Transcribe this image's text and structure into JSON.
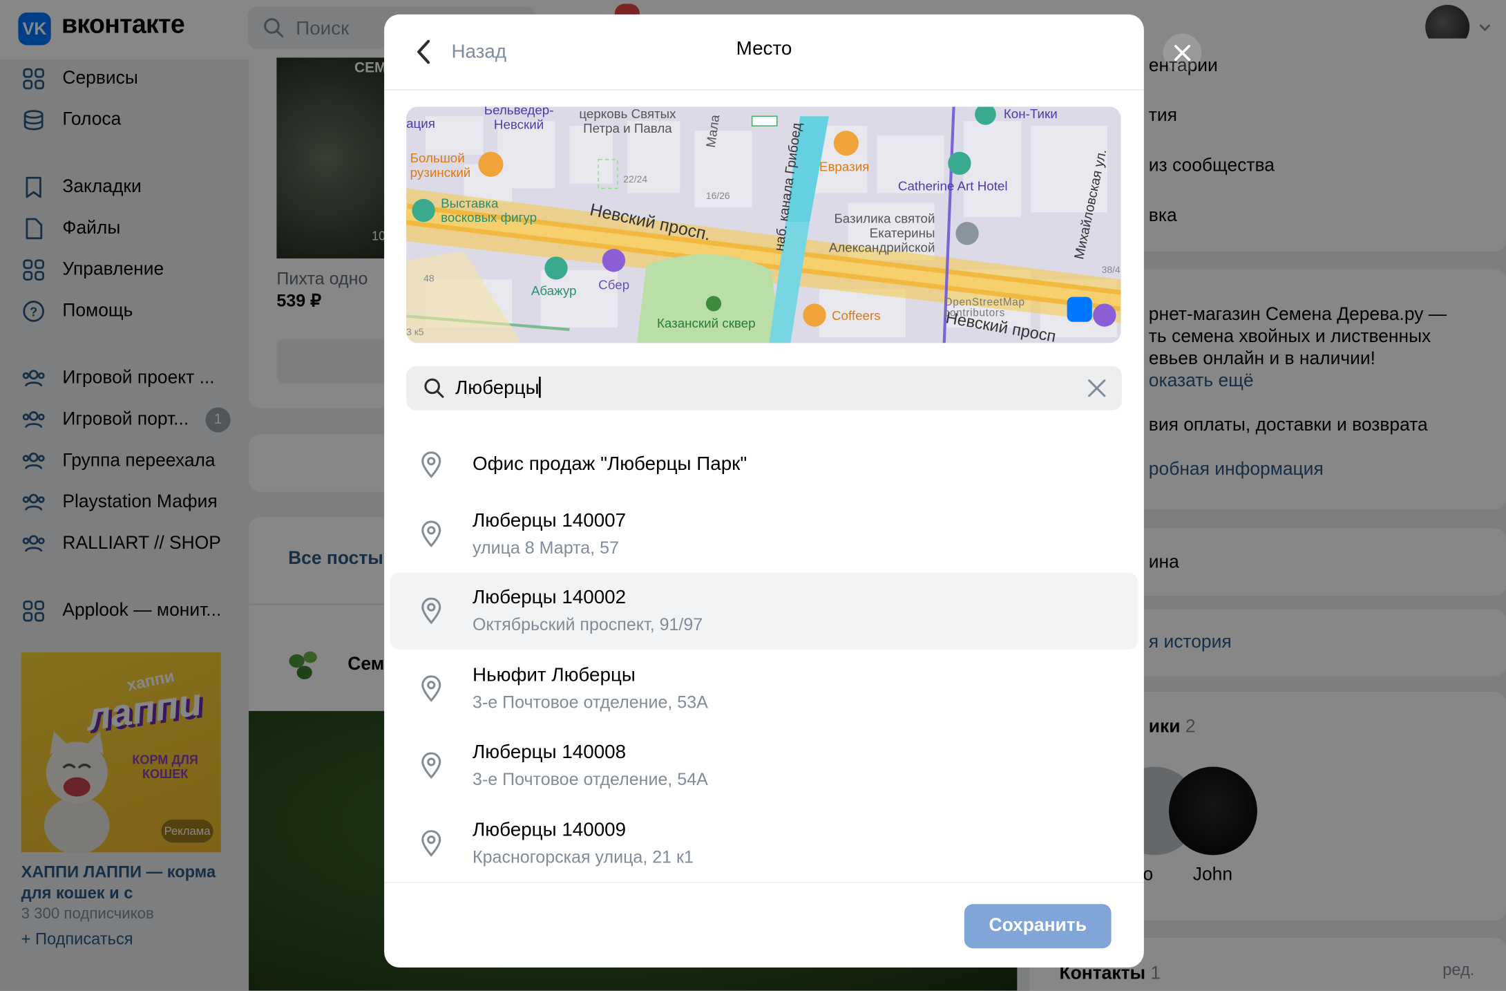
{
  "app": {
    "name": "вконтакте",
    "logo": "VK"
  },
  "header": {
    "search_placeholder": "Поиск"
  },
  "sidebar": {
    "items": [
      {
        "label": "Сервисы",
        "icon": "grid-icon"
      },
      {
        "label": "Голоса",
        "icon": "coins-icon"
      },
      {
        "label": "Закладки",
        "icon": "bookmark-icon"
      },
      {
        "label": "Файлы",
        "icon": "file-icon"
      },
      {
        "label": "Управление",
        "icon": "grid-icon"
      },
      {
        "label": "Помощь",
        "icon": "help-icon"
      },
      {
        "label": "Игровой проект ...",
        "icon": "group-icon"
      },
      {
        "label": "Игровой порт...",
        "icon": "group-icon",
        "badge": "1"
      },
      {
        "label": "Группа переехала",
        "icon": "group-icon"
      },
      {
        "label": "Playstation Мафия",
        "icon": "group-icon"
      },
      {
        "label": "RALLIART // SHOP",
        "icon": "group-icon"
      },
      {
        "label": "Applook — монит...",
        "icon": "grid-icon"
      }
    ],
    "ad": {
      "brand_small": "хаппи",
      "brand_big": "лаппи",
      "tagline": "КОРМ ДЛЯ КОШЕК",
      "ad_label": "Реклама",
      "title": "ХАППИ ЛАППИ — корма для кошек и с",
      "subscribers": "3 300 подписчиков",
      "subscribe": "Подписаться"
    }
  },
  "feed": {
    "product_caption": "Пихта одно",
    "product_price": "539 ₽",
    "product_badge": "СЕМ",
    "product_counter": "10",
    "posts_tab": "Все посты",
    "author_short": "Сем"
  },
  "right": {
    "menu": [
      "ентарии",
      "тия",
      "из сообщества",
      "вка"
    ],
    "description": [
      "рнет-магазин Семена Дерева.ру —",
      "ть семена хвойных и лиственных",
      "евьев онлайн и в наличии!"
    ],
    "show_more": "оказать ещё",
    "conditions": "вия оплаты, доставки и возврата",
    "more_info": "робная информация",
    "item_a": "ина",
    "item_b": "я история",
    "members_title": "ики",
    "members_count": "2",
    "member_a_tail": "о",
    "member_name": "John",
    "contacts_title": "Контакты",
    "contacts_count": "1",
    "edit": "ред."
  },
  "modal": {
    "back": "Назад",
    "title": "Место",
    "search_value": "Люберцы",
    "results": [
      {
        "title": "Офис продаж \"Люберцы Парк\"",
        "subtitle": ""
      },
      {
        "title": "Люберцы 140007",
        "subtitle": "улица 8 Марта, 57"
      },
      {
        "title": "Люберцы 140002",
        "subtitle": "Октябрьский проспект, 91/97"
      },
      {
        "title": "Ньюфит Люберцы",
        "subtitle": "3-е Почтовое отделение, 53А"
      },
      {
        "title": "Люберцы 140008",
        "subtitle": "3-е Почтовое отделение, 54А"
      },
      {
        "title": "Люберцы 140009",
        "subtitle": "Красногорская улица, 21 к1"
      }
    ],
    "save": "Сохранить",
    "map_labels": {
      "belveder": "Бельведер-\nНевский",
      "church": "церковь Святых\nПетра и Павла",
      "mala": "Мала",
      "kanal": "наб. канала Грибоед",
      "kontiki": "Кон-Тики",
      "mikh": "Михайловская ул.",
      "bolshoy": "Большой\nрузинский",
      "evraziya": "Евразия",
      "catherine": "Catherine Art Hotel",
      "n2224": "22/24",
      "n1626": "16/26",
      "vystavka": "Выставка\nвосковых фигур",
      "nevsky": "Невский просп.",
      "bazilika": "Базилика святой\nЕкатерины\nАлександрийской",
      "n48": "48",
      "abazhur": "Абажур",
      "sber": "Сбер",
      "n384": "38/4",
      "kazansky": "Казанский сквер",
      "coffeers": "Coffeers",
      "osm": "OpenStreetMap\ncontributors",
      "nevsky2": "Невский просп",
      "n3k5": "3 к5",
      "tsiya": "ация"
    }
  }
}
